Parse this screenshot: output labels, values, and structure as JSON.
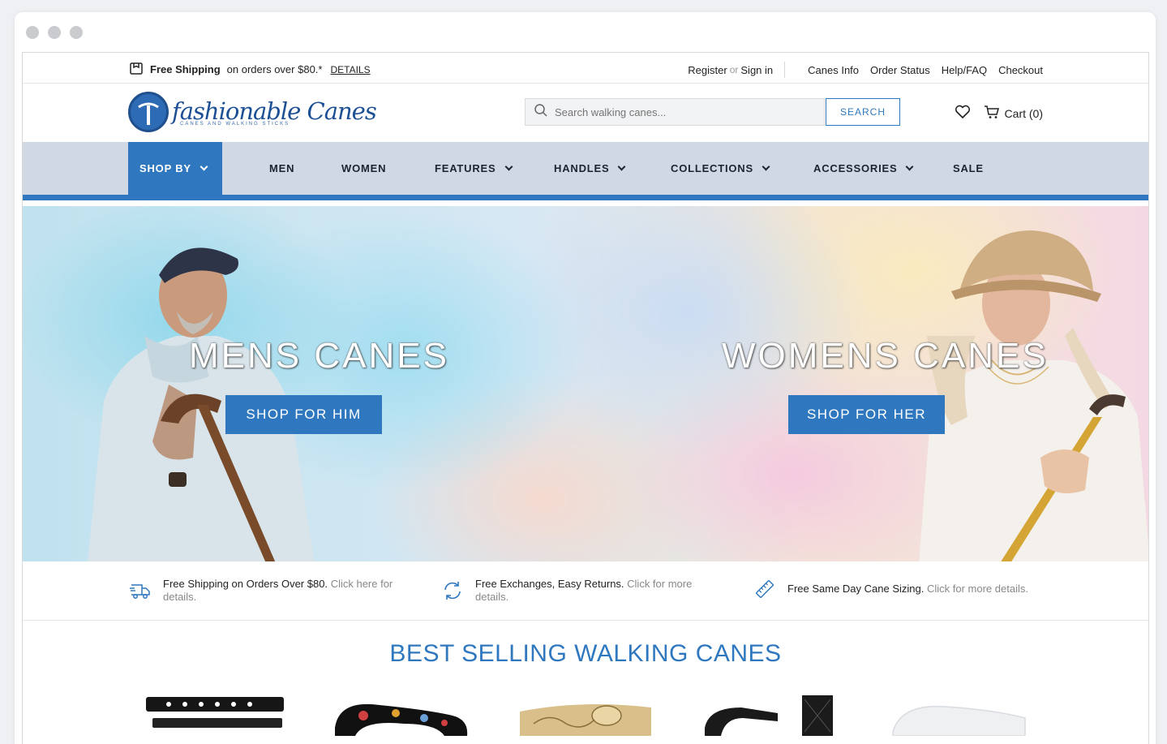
{
  "utility": {
    "free_shipping_bold": "Free Shipping",
    "free_shipping_rest": "on orders over $80.*",
    "details_link": "DETAILS",
    "register": "Register",
    "or": "or",
    "sign_in": "Sign in",
    "links": [
      "Canes Info",
      "Order Status",
      "Help/FAQ",
      "Checkout"
    ]
  },
  "header": {
    "logo_text": "fashionable Canes",
    "logo_tagline": "CANES AND WALKING STICKS",
    "search_placeholder": "Search walking canes...",
    "search_button": "SEARCH",
    "cart_label": "Cart (0)"
  },
  "nav": {
    "items": [
      {
        "label": "SHOP BY"
      },
      {
        "label": "MEN"
      },
      {
        "label": "WOMEN"
      },
      {
        "label": "FEATURES"
      },
      {
        "label": "HANDLES"
      },
      {
        "label": "COLLECTIONS"
      },
      {
        "label": "ACCESSORIES"
      },
      {
        "label": "SALE"
      }
    ]
  },
  "hero": {
    "mens_title": "MENS CANES",
    "mens_button": "SHOP FOR HIM",
    "womens_title": "WOMENS CANES",
    "womens_button": "SHOP FOR HER"
  },
  "benefits": [
    {
      "bold": "Free Shipping on Orders Over $80.",
      "more": "Click here for details.",
      "icon": "shipping-truck-icon"
    },
    {
      "bold": "Free Exchanges, Easy Returns.",
      "more": "Click for more details.",
      "icon": "refresh-icon"
    },
    {
      "bold": "Free Same Day Cane Sizing.",
      "more": "Click for more details.",
      "icon": "ruler-icon"
    }
  ],
  "best_sellers": {
    "title": "BEST SELLING WALKING CANES"
  },
  "colors": {
    "brand_blue": "#2f78bf",
    "nav_bg": "#d0d9e3"
  }
}
